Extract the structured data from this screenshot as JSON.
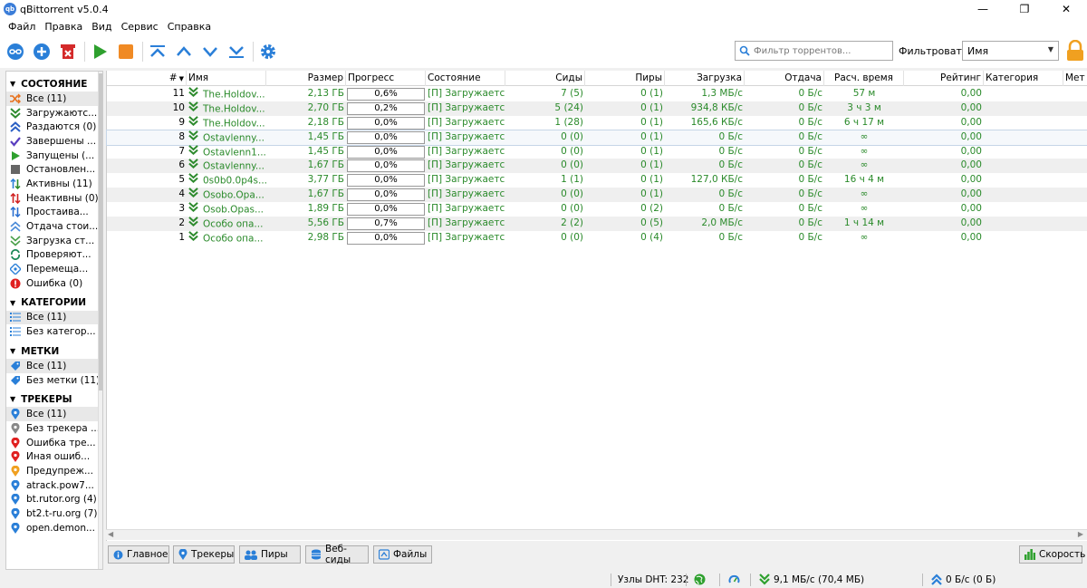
{
  "window": {
    "title": "qBittorrent v5.0.4",
    "icon_text": "qb"
  },
  "menu": [
    "Файл",
    "Правка",
    "Вид",
    "Сервис",
    "Справка"
  ],
  "toolbar": {
    "search_placeholder": "Фильтр торрентов...",
    "filter_label": "Фильтровать:",
    "filter_value": "Имя"
  },
  "sidebar": {
    "sections": [
      {
        "title": "СОСТОЯНИЕ",
        "items": [
          {
            "label": "Все (11)",
            "icon": "shuffle-icon",
            "color": "#e8701a",
            "sel": true
          },
          {
            "label": "Загружаютс...",
            "icon": "download-icon",
            "color": "#2e8b2e"
          },
          {
            "label": "Раздаются (0)",
            "icon": "upload-icon",
            "color": "#2a5fc4"
          },
          {
            "label": "Завершены ...",
            "icon": "check-icon",
            "color": "#5a3fc0"
          },
          {
            "label": "Запущены (...",
            "icon": "play-icon",
            "color": "#2ea02e"
          },
          {
            "label": "Остановлен...",
            "icon": "stop-icon",
            "color": "#666666"
          },
          {
            "label": "Активны (11)",
            "icon": "active-arrows-icon",
            "color": "#2a8a2a"
          },
          {
            "label": "Неактивны (0)",
            "icon": "inactive-arrows-icon",
            "color": "#d02020"
          },
          {
            "label": "Простаива...",
            "icon": "stalled-arrows-icon",
            "color": "#2a6fd0"
          },
          {
            "label": "Отдача стои...",
            "icon": "stalled-upload-icon",
            "color": "#4a8ad8"
          },
          {
            "label": "Загрузка ст...",
            "icon": "stalled-download-icon",
            "color": "#4aa04a"
          },
          {
            "label": "Проверяют...",
            "icon": "checking-icon",
            "color": "#1f8a5a"
          },
          {
            "label": "Перемеща...",
            "icon": "moving-icon",
            "color": "#2a7fd8"
          },
          {
            "label": "Ошибка (0)",
            "icon": "error-icon",
            "color": "#e02020"
          }
        ]
      },
      {
        "title": "КАТЕГОРИИ",
        "items": [
          {
            "label": "Все (11)",
            "icon": "list-icon",
            "color": "#2a7fd8",
            "sel": true
          },
          {
            "label": "Без категор...",
            "icon": "list-icon",
            "color": "#2a7fd8"
          }
        ]
      },
      {
        "title": "МЕТКИ",
        "items": [
          {
            "label": "Все (11)",
            "icon": "tag-icon",
            "color": "#2a7fd8",
            "sel": true
          },
          {
            "label": "Без метки (11)",
            "icon": "tag-icon",
            "color": "#2a7fd8"
          }
        ]
      },
      {
        "title": "ТРЕКЕРЫ",
        "items": [
          {
            "label": "Все (11)",
            "icon": "pin-icon",
            "color": "#2a7fd8",
            "sel": true
          },
          {
            "label": "Без трекера ...",
            "icon": "pin-icon",
            "color": "#888888"
          },
          {
            "label": "Ошибка тре...",
            "icon": "pin-icon",
            "color": "#e02020"
          },
          {
            "label": "Иная ошиб...",
            "icon": "pin-icon",
            "color": "#e02020"
          },
          {
            "label": "Предупреж...",
            "icon": "pin-icon",
            "color": "#f0a020"
          },
          {
            "label": "atrack.pow7...",
            "icon": "pin-icon",
            "color": "#2a7fd8"
          },
          {
            "label": "bt.rutor.org (4)",
            "icon": "pin-icon",
            "color": "#2a7fd8"
          },
          {
            "label": "bt2.t-ru.org (7)",
            "icon": "pin-icon",
            "color": "#2a7fd8"
          },
          {
            "label": "open.demon...",
            "icon": "pin-icon",
            "color": "#2a7fd8"
          }
        ]
      }
    ]
  },
  "table": {
    "columns": [
      "#",
      "Имя",
      "Размер",
      "Прогресс",
      "Состояние",
      "Сиды",
      "Пиры",
      "Загрузка",
      "Отдача",
      "Расч. время",
      "Рейтинг",
      "Категория",
      "Мет"
    ],
    "rows": [
      {
        "n": "11",
        "name": "The.Holdov...",
        "size": "2,13 ГБ",
        "progress": "0,6%",
        "state": "[П] Загружается",
        "seeds": "7 (5)",
        "peers": "0 (1)",
        "down": "1,3 МБ/с",
        "up": "0 Б/с",
        "eta": "57 м",
        "ratio": "0,00"
      },
      {
        "n": "10",
        "name": "The.Holdov...",
        "size": "2,70 ГБ",
        "progress": "0,2%",
        "state": "[П] Загружается",
        "seeds": "5 (24)",
        "peers": "0 (1)",
        "down": "934,8 КБ/с",
        "up": "0 Б/с",
        "eta": "3 ч 3 м",
        "ratio": "0,00"
      },
      {
        "n": "9",
        "name": "The.Holdov...",
        "size": "2,18 ГБ",
        "progress": "0,0%",
        "state": "[П] Загружается",
        "seeds": "1 (28)",
        "peers": "0 (1)",
        "down": "165,6 КБ/с",
        "up": "0 Б/с",
        "eta": "6 ч 17 м",
        "ratio": "0,00"
      },
      {
        "n": "8",
        "name": "Ostavlenny...",
        "size": "1,45 ГБ",
        "progress": "0,0%",
        "state": "[П] Загружается",
        "seeds": "0 (0)",
        "peers": "0 (1)",
        "down": "0 Б/с",
        "up": "0 Б/с",
        "eta": "∞",
        "ratio": "0,00",
        "sel": true
      },
      {
        "n": "7",
        "name": "Ostavlenn1...",
        "size": "1,45 ГБ",
        "progress": "0,0%",
        "state": "[П] Загружается",
        "seeds": "0 (0)",
        "peers": "0 (1)",
        "down": "0 Б/с",
        "up": "0 Б/с",
        "eta": "∞",
        "ratio": "0,00"
      },
      {
        "n": "6",
        "name": "Ostavlenny...",
        "size": "1,67 ГБ",
        "progress": "0,0%",
        "state": "[П] Загружается",
        "seeds": "0 (0)",
        "peers": "0 (1)",
        "down": "0 Б/с",
        "up": "0 Б/с",
        "eta": "∞",
        "ratio": "0,00"
      },
      {
        "n": "5",
        "name": "0s0b0.0p4s...",
        "size": "3,77 ГБ",
        "progress": "0,0%",
        "state": "[П] Загружается",
        "seeds": "1 (1)",
        "peers": "0 (1)",
        "down": "127,0 КБ/с",
        "up": "0 Б/с",
        "eta": "16 ч 4 м",
        "ratio": "0,00"
      },
      {
        "n": "4",
        "name": "Osobo.Opa...",
        "size": "1,67 ГБ",
        "progress": "0,0%",
        "state": "[П] Загружается",
        "seeds": "0 (0)",
        "peers": "0 (1)",
        "down": "0 Б/с",
        "up": "0 Б/с",
        "eta": "∞",
        "ratio": "0,00"
      },
      {
        "n": "3",
        "name": "Osob.Opas...",
        "size": "1,89 ГБ",
        "progress": "0,0%",
        "state": "[П] Загружается",
        "seeds": "0 (0)",
        "peers": "0 (2)",
        "down": "0 Б/с",
        "up": "0 Б/с",
        "eta": "∞",
        "ratio": "0,00"
      },
      {
        "n": "2",
        "name": "Особо опа...",
        "size": "5,56 ГБ",
        "progress": "0,7%",
        "state": "[П] Загружается",
        "seeds": "2 (2)",
        "peers": "0 (5)",
        "down": "2,0 МБ/с",
        "up": "0 Б/с",
        "eta": "1 ч 14 м",
        "ratio": "0,00"
      },
      {
        "n": "1",
        "name": "Особо опа...",
        "size": "2,98 ГБ",
        "progress": "0,0%",
        "state": "[П] Загружается",
        "seeds": "0 (0)",
        "peers": "0 (4)",
        "down": "0 Б/с",
        "up": "0 Б/с",
        "eta": "∞",
        "ratio": "0,00"
      }
    ]
  },
  "tabs": [
    "Главное",
    "Трекеры",
    "Пиры",
    "Веб-сиды",
    "Файлы"
  ],
  "speed_button": "Скорость",
  "status": {
    "dht": "Узлы DHT: 232",
    "down": "9,1 МБ/с (70,4 МБ)",
    "up": "0 Б/с (0 Б)"
  },
  "colors": {
    "accent": "#2a7fd8",
    "green_text": "#2a8a2a",
    "play": "#2ea02e",
    "stop": "#f08a24",
    "delete": "#d42a2a"
  }
}
